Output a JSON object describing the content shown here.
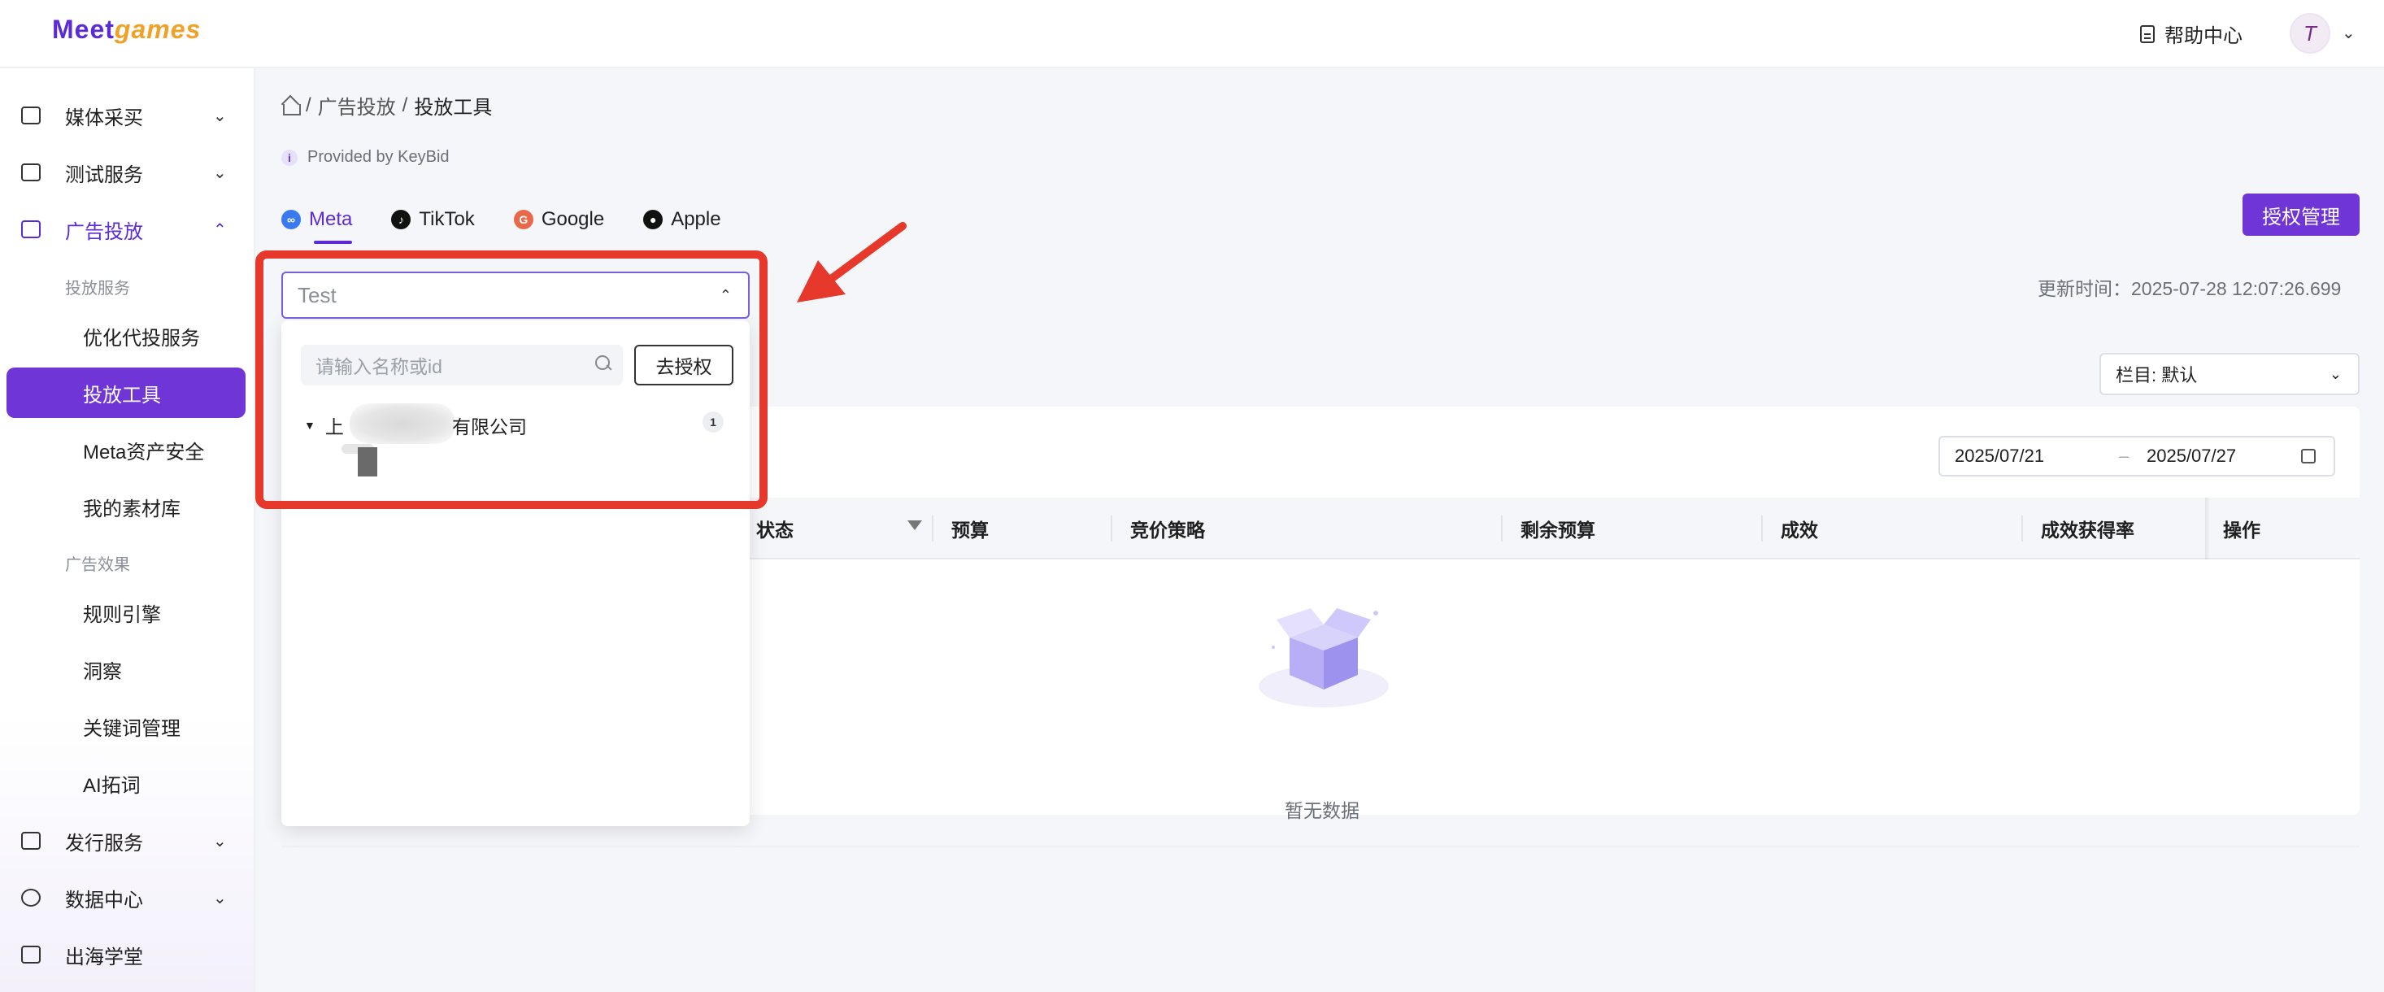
{
  "header": {
    "logo_meet": "Meet",
    "logo_games": "games",
    "help_label": "帮助中心",
    "avatar_initial": "T",
    "icons": {
      "help": "document-icon",
      "avatar_menu": "chevron-down-icon"
    }
  },
  "sidebar": {
    "groups": [
      {
        "label": "媒体采买",
        "icon": "media-icon"
      },
      {
        "label": "测试服务",
        "icon": "test-icon"
      },
      {
        "label": "广告投放",
        "icon": "ad-icon"
      },
      {
        "label": "发行服务",
        "icon": "publish-icon"
      },
      {
        "label": "数据中心",
        "icon": "data-icon"
      },
      {
        "label": "出海学堂",
        "icon": "academy-icon"
      }
    ],
    "sections": [
      "投放服务",
      "广告效果"
    ],
    "items": [
      {
        "label": "优化代投服务"
      },
      {
        "label": "投放工具"
      },
      {
        "label": "Meta资产安全"
      },
      {
        "label": "我的素材库"
      },
      {
        "label": "规则引擎"
      },
      {
        "label": "洞察"
      },
      {
        "label": "关键词管理"
      },
      {
        "label": "AI拓词"
      }
    ],
    "active_color": "#6f35d6"
  },
  "breadcrumb": {
    "sep": "/",
    "items": [
      "广告投放",
      "投放工具"
    ]
  },
  "provided_by": "Provided by KeyBid",
  "tabs": [
    {
      "label": "Meta",
      "icon": "meta-icon"
    },
    {
      "label": "TikTok",
      "icon": "tiktok-icon"
    },
    {
      "label": "Google",
      "icon": "google-icon"
    },
    {
      "label": "Apple",
      "icon": "apple-icon"
    }
  ],
  "toolbar": {
    "auth_button": "授权管理",
    "update_time": "更新时间：2025-07-28 12:07:26.699",
    "column_select": "栏目: 默认"
  },
  "account_select": {
    "value": "Test",
    "search_placeholder": "请输入名称或id",
    "go_auth_button": "去授权",
    "tree": [
      {
        "prefix": "上",
        "suffix": "有限公司",
        "count": "1"
      }
    ]
  },
  "date_range": {
    "start": "2025/07/21",
    "sep": "–",
    "end": "2025/07/27"
  },
  "table": {
    "columns": [
      "状态",
      "预算",
      "竞价策略",
      "剩余预算",
      "成效",
      "成效获得率",
      "操作"
    ],
    "empty_text": "暂无数据"
  },
  "colors": {
    "accent": "#6f35d6",
    "annotation": "#e7392b"
  }
}
